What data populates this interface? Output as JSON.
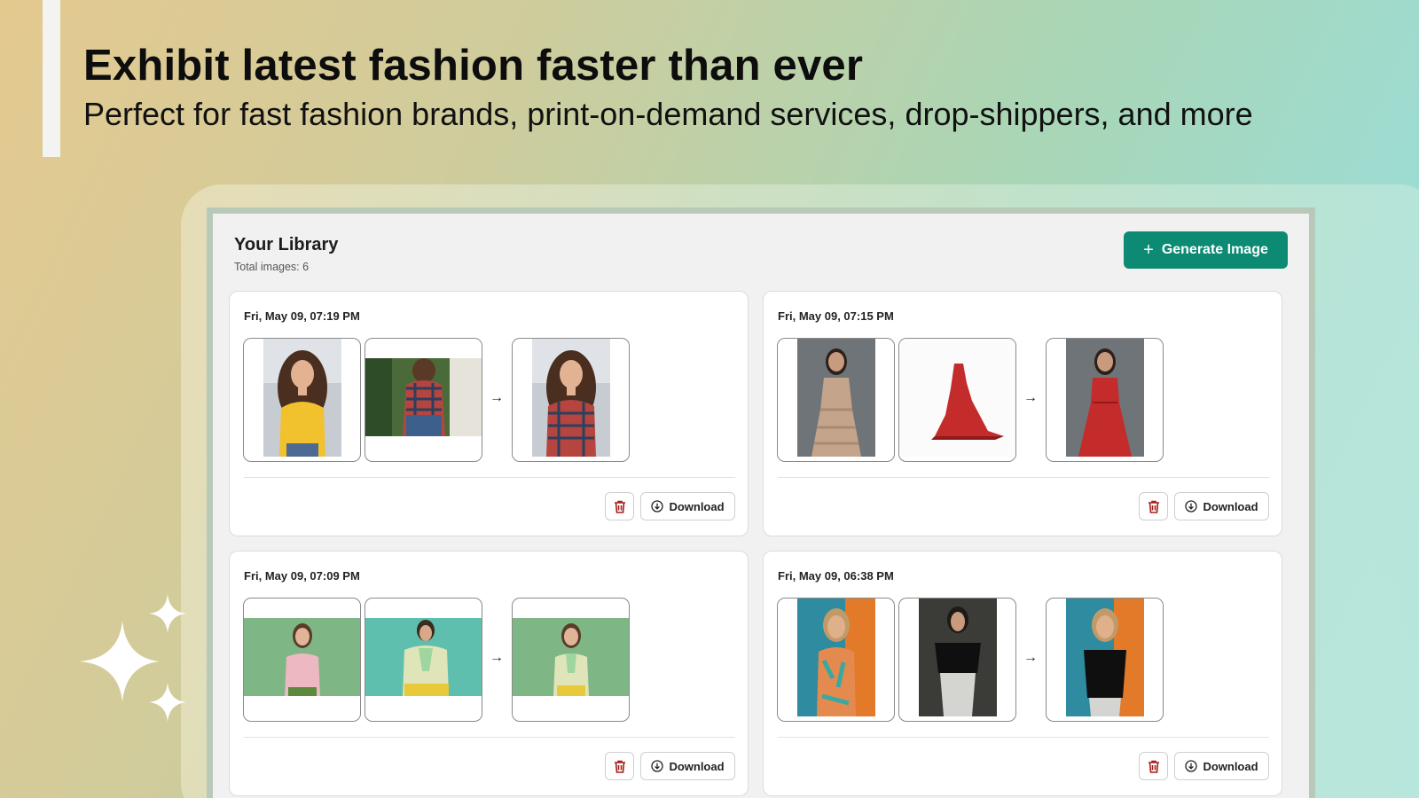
{
  "hero": {
    "title": "Exhibit latest fashion faster than ever",
    "subtitle": "Perfect for fast fashion brands, print-on-demand services, drop-shippers, and more"
  },
  "library": {
    "title": "Your Library",
    "total_label": "Total images: 6",
    "generate_button": "Generate Image"
  },
  "colors": {
    "accent": "#0d8a73",
    "trash": "#a3201b"
  },
  "cards": [
    {
      "date": "Fri, May 09, 07:19 PM",
      "download_label": "Download"
    },
    {
      "date": "Fri, May 09, 07:15 PM",
      "download_label": "Download"
    },
    {
      "date": "Fri, May 09, 07:09 PM",
      "download_label": "Download"
    },
    {
      "date": "Fri, May 09, 06:38 PM",
      "download_label": "Download"
    }
  ],
  "icons": {
    "arrow": "→",
    "plus": "+",
    "trash": "trash-icon",
    "download": "download-icon",
    "sparkle": "sparkle-icon"
  }
}
